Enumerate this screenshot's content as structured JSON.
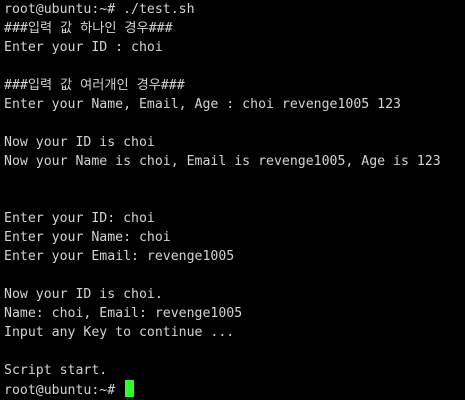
{
  "terminal": {
    "lines": [
      "root@ubuntu:~# ./test.sh",
      "###입력 값 하나인 경우###",
      "Enter your ID : choi",
      "",
      "###입력 값 여러개인 경우###",
      "Enter your Name, Email, Age : choi revenge1005 123",
      "",
      "Now your ID is choi",
      "Now your Name is choi, Email is revenge1005, Age is 123",
      "",
      "",
      "Enter your ID: choi",
      "Enter your Name: choi",
      "Enter your Email: revenge1005",
      "",
      "Now your ID is choi.",
      "Name: choi, Email: revenge1005",
      "Input any Key to continue ...",
      "",
      "Script start.",
      "root@ubuntu:~# "
    ],
    "colors": {
      "background": "#000000",
      "foreground": "#d3d3d3",
      "cursor": "#2cff2c"
    }
  }
}
